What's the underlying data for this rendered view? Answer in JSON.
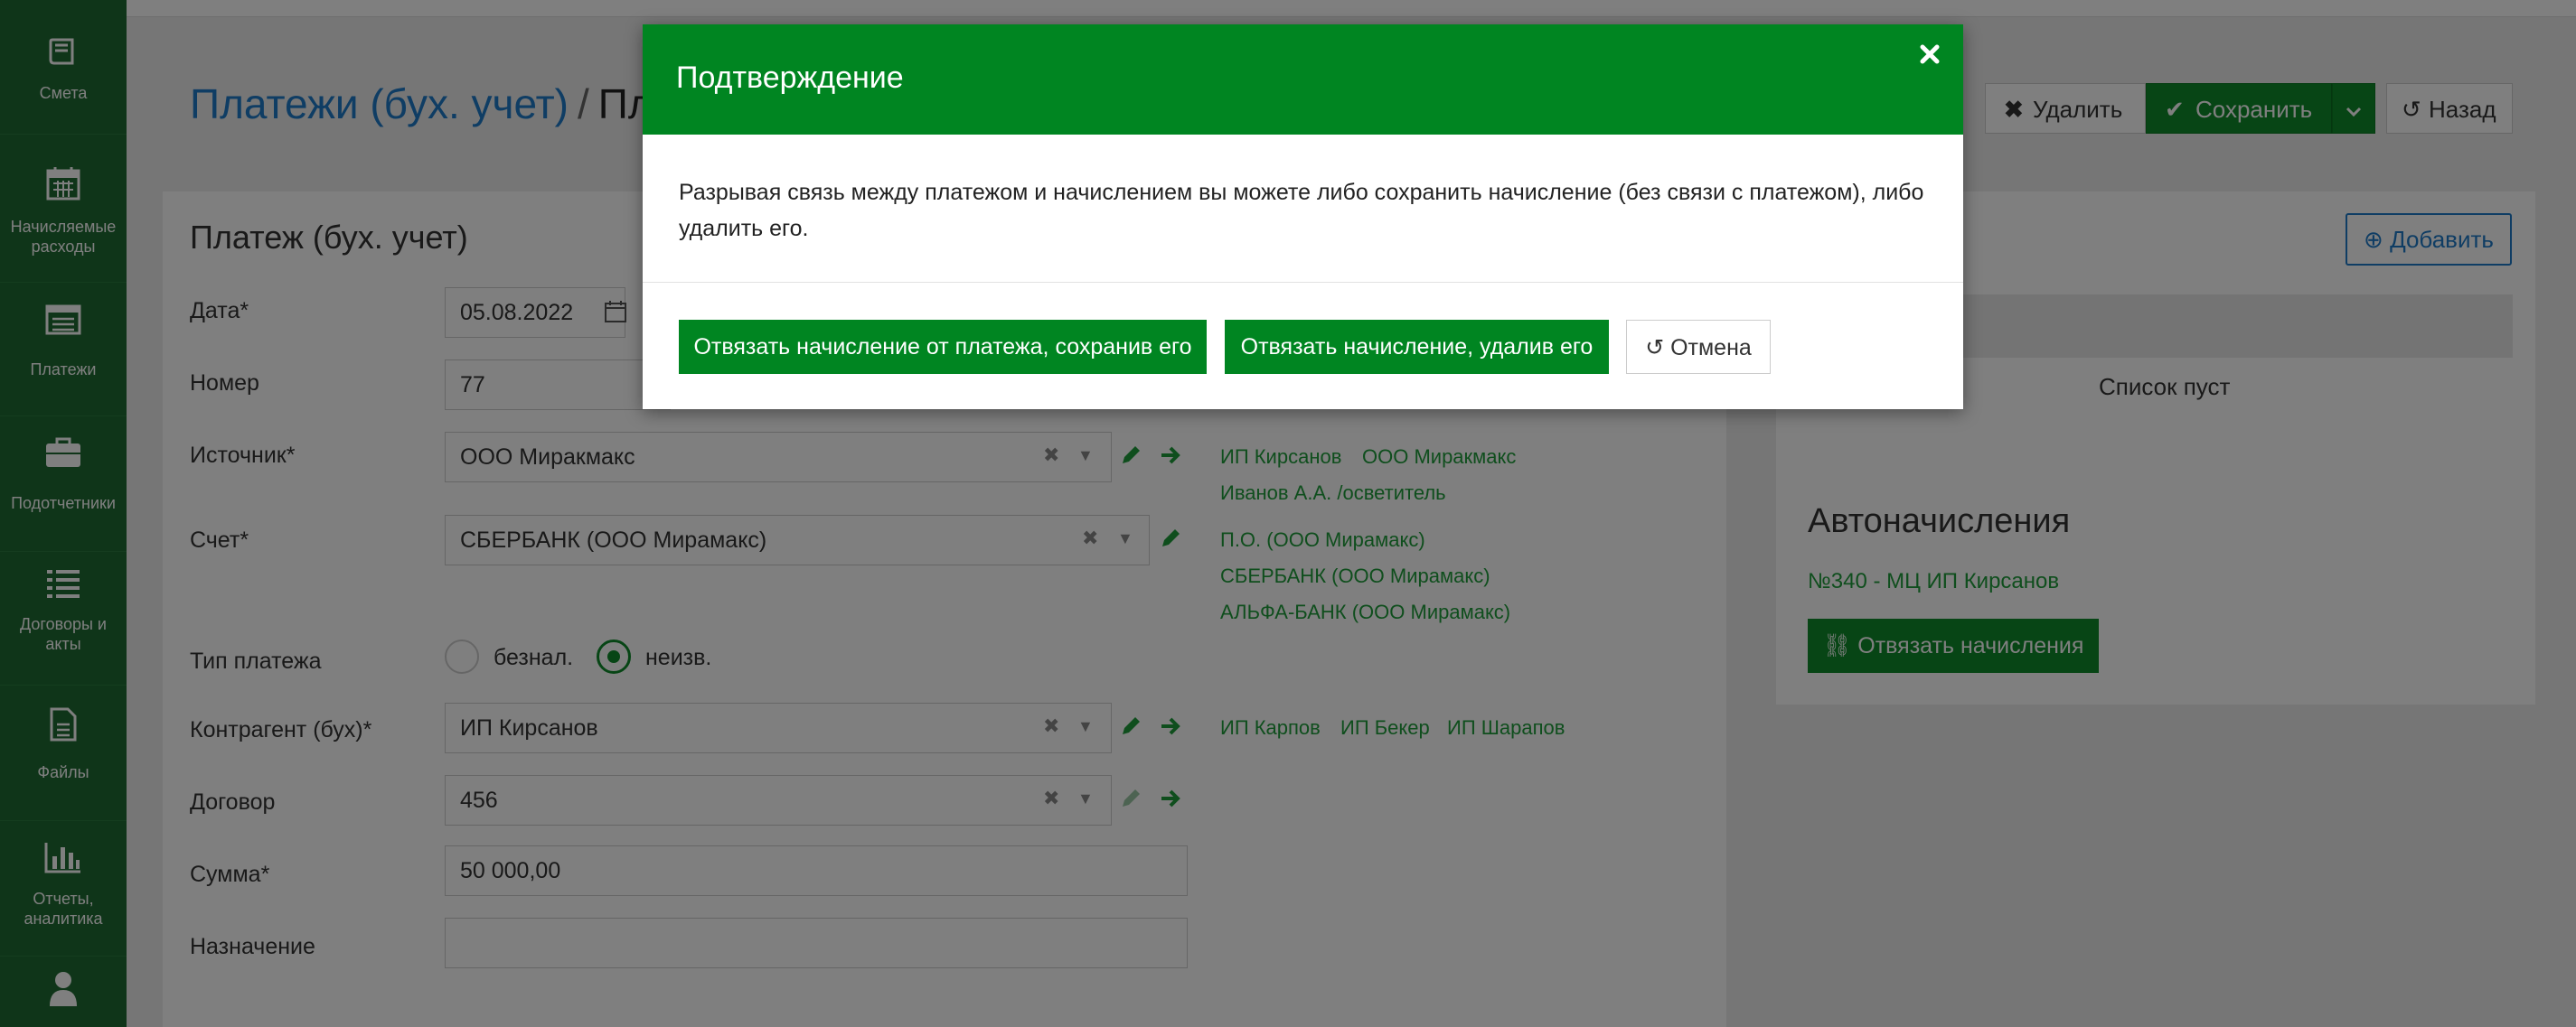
{
  "sidebar": {
    "items": [
      {
        "label": "Смета",
        "icon": "book-icon"
      },
      {
        "label": "Начисляемые расходы",
        "icon": "calendar-icon"
      },
      {
        "label": "Платежи",
        "icon": "list-window-icon"
      },
      {
        "label": "Подотчетники",
        "icon": "briefcase-icon"
      },
      {
        "label": "Договоры и акты",
        "icon": "list-icon"
      },
      {
        "label": "Файлы",
        "icon": "file-icon"
      },
      {
        "label": "Отчеты, аналитика",
        "icon": "bar-chart-icon"
      },
      {
        "label": "",
        "icon": "user-icon"
      }
    ]
  },
  "header": {
    "breadcrumb_link": "Платежи (бух. учет)",
    "breadcrumb_sep": "/",
    "breadcrumb_current": "Пл",
    "delete_label": "Удалить",
    "save_label": "Сохранить",
    "back_label": "Назад"
  },
  "form": {
    "title": "Платеж (бух. учет)",
    "date_label": "Дата",
    "date_value": "05.08.2022",
    "number_label": "Номер",
    "number_value": "77",
    "source_label": "Источник",
    "source_value": "ООО Миракмакс",
    "source_links": [
      "ИП Кирсанов",
      "ООО Миракмакс",
      "Иванов А.А. /осветитель"
    ],
    "account_label": "Счет",
    "account_value": "СБЕРБАНК (ООО Мирамакс)",
    "account_links": [
      "П.О. (ООО Мирамакс)",
      "СБЕРБАНК (ООО Мирамакс)",
      "АЛЬФА-БАНК (ООО Мирамакс)"
    ],
    "paytype_label": "Тип платежа",
    "paytype_options": [
      "безнал.",
      "неизв."
    ],
    "paytype_selected": "неизв.",
    "counterparty_label": "Контрагент (бух)",
    "counterparty_value": "ИП Кирсанов",
    "counterparty_links": [
      "ИП Карпов",
      "ИП Бекер",
      "ИП Шарапов"
    ],
    "contract_label": "Договор",
    "contract_value": "456",
    "sum_label": "Сумма",
    "sum_value": "50 000,00",
    "purpose_label": "Назначение",
    "purpose_value": "",
    "required_mark": "*"
  },
  "right_panel": {
    "add_label": "Добавить",
    "empty_text": "Список пуст",
    "auto_title": "Автоначисления",
    "auto_link": "№340 - МЦ ИП Кирсанов",
    "unlink_label": "Отвязать начисления"
  },
  "modal": {
    "title": "Подтверждение",
    "body": "Разрывая связь между платежом и начислением вы можете либо сохранить начисление (без связи с платежом), либо удалить его.",
    "keep_button": "Отвязать начисление от платежа, сохранив его",
    "delete_button": "Отвязать начисление, удалив его",
    "cancel_button": "Отмена"
  },
  "colors": {
    "sidebar": "#1f6b33",
    "primary_green": "#008521",
    "link_blue": "#1e7ac8",
    "link_green": "#1e9d3a"
  }
}
